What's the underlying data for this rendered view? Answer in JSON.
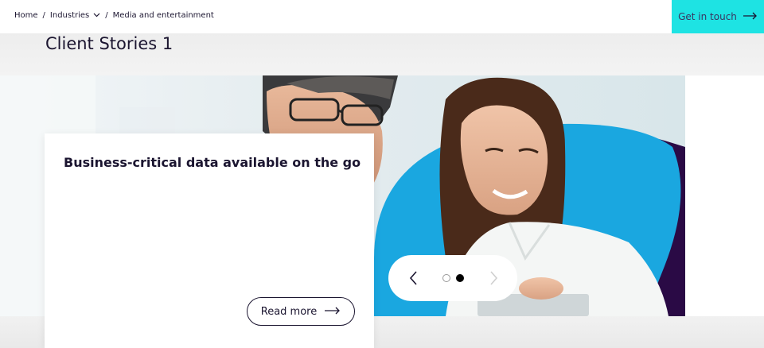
{
  "breadcrumb": {
    "home": "Home",
    "sep1": "/",
    "industries": "Industries",
    "sep2": "/",
    "current": "Media and entertainment"
  },
  "header": {
    "cta_label": "Get in touch"
  },
  "section": {
    "title": "Client Stories 1"
  },
  "card": {
    "title": "Business-critical data available on the go",
    "read_more_label": "Read more"
  },
  "carousel": {
    "total_slides": 2,
    "active_slide": 2
  },
  "colors": {
    "accent": "#1ee3e3",
    "text": "#1b1530",
    "blob_blue": "#1aa7e0",
    "blob_purple": "#2a0a45"
  },
  "icons": [
    "chevron-down-icon",
    "arrow-right-icon",
    "chevron-left-icon",
    "chevron-right-icon"
  ]
}
